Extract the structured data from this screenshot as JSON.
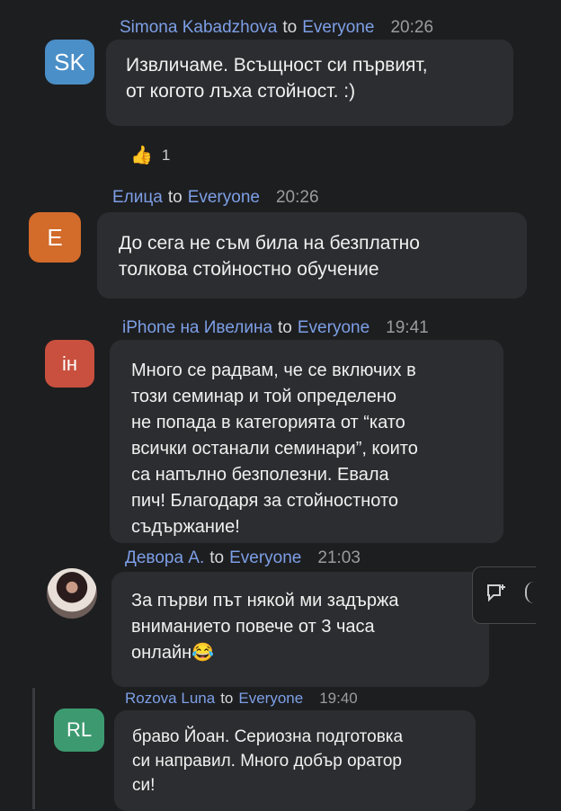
{
  "messages": [
    {
      "sender": "Simona Kabadzhova",
      "to": "to",
      "target": "Everyone",
      "time": "20:26",
      "avatar_initials": "SK",
      "avatar_color": "#4a8fc7",
      "text": "Извличаме. Всъщност си първият,\nот когото лъха стойност. :)",
      "reaction": {
        "icon": "thumbs-up-icon",
        "count": "1"
      }
    },
    {
      "sender": "Елица",
      "to": "to",
      "target": "Everyone",
      "time": "20:26",
      "avatar_initials": "E",
      "avatar_color": "#d36b2a",
      "text": "До сега не съм била на безплатно\nтолкова стойностно обучение"
    },
    {
      "sender": "iPhone на Ивелина",
      "to": "to",
      "target": "Everyone",
      "time": "19:41",
      "avatar_initials": "iн",
      "avatar_color": "#c9503e",
      "text": "Много се радвам, че се включих в\nтози семинар и той определено\nне попада в категорията от “като\nвсички останали семинари”, които\nса напълно безполезни. Евала\nпич! Благодаря за стойностното\nсъдържание!"
    },
    {
      "sender": "Девора А.",
      "to": "to",
      "target": "Everyone",
      "time": "21:03",
      "avatar_initials": "",
      "avatar_color": "#3b3030",
      "text": "За първи път някой ми задържа\nвниманието повече от 3 часа\nонлайн😂"
    },
    {
      "sender": "Rozova Luna",
      "to": "to",
      "target": "Everyone",
      "time": "19:40",
      "avatar_initials": "RL",
      "avatar_color": "#3d9a70",
      "text": "браво Йоан. Сериозна подготовка\nси направил. Много добър оратор\nси!"
    }
  ],
  "side_tool": {
    "icon": "reply-in-thread-icon"
  }
}
